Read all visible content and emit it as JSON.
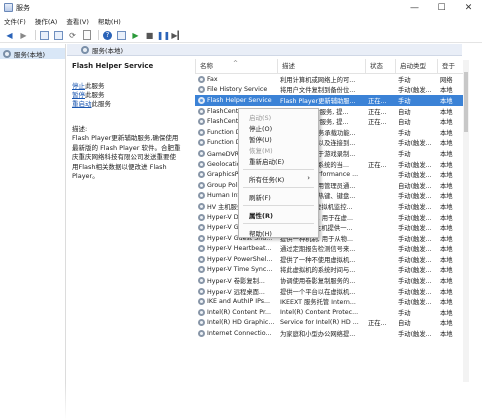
{
  "window": {
    "title": "服务",
    "controls": {
      "minimize": "—",
      "maximize": "☐",
      "close": "✕"
    }
  },
  "menubar": [
    "文件(F)",
    "操作(A)",
    "查看(V)",
    "帮助(H)"
  ],
  "tree": {
    "root": "服务(本地)"
  },
  "pane": {
    "header": "服务(本地)"
  },
  "description": {
    "service_name": "Flash Helper Service",
    "links": [
      {
        "link": "停止",
        "rest": "此服务"
      },
      {
        "link": "暂停",
        "rest": "此服务"
      },
      {
        "link": "重启动",
        "rest": "此服务"
      }
    ],
    "label": "描述:",
    "lines": [
      "Flash Player更新辅助服务,确保使用",
      "最新版的 Flash Player 软件。合肥重",
      "庆重庆网络科技有限公司发送重要使",
      "用Flash相关数据以便改进 Flash",
      "Player。"
    ]
  },
  "table": {
    "headers": [
      "名称",
      "描述",
      "状态",
      "启动类型",
      "登于"
    ],
    "rows": [
      {
        "name": "Fax",
        "desc": "利用计算机或网络上的可...",
        "status": "",
        "start": "手动",
        "logon": "网络"
      },
      {
        "name": "File History Service",
        "desc": "将用户文件复制到备份位...",
        "status": "",
        "start": "手动(触发...",
        "logon": "本地"
      },
      {
        "name": "Flash Helper Service",
        "desc": "Flash Player更新辅助服...",
        "status": "正在...",
        "start": "手动",
        "logon": "本地"
      },
      {
        "name": "FlashCenterSvc",
        "desc": "Flash Center服务, 提...",
        "status": "正在...",
        "start": "自动",
        "logon": "本地"
      },
      {
        "name": "FlashCenterSvc",
        "desc": "Flash Center服务, 提...",
        "status": "正在...",
        "start": "自动",
        "logon": "本地"
      },
      {
        "name": "Function Discovery...",
        "desc": "FDPHOST 服务承载功能...",
        "status": "",
        "start": "手动",
        "logon": "本地"
      },
      {
        "name": "Function Discovery...",
        "desc": "发布该计算机以及连接到...",
        "status": "",
        "start": "手动(触发...",
        "logon": "本地"
      },
      {
        "name": "GameDVR 和广播...",
        "desc": "此用户服务用于游戏录制...",
        "status": "",
        "start": "手动",
        "logon": "本地"
      },
      {
        "name": "Geolocation Service",
        "desc": "此服务将监视系统的当...",
        "status": "正在...",
        "start": "手动(触发...",
        "logon": "本地"
      },
      {
        "name": "GraphicsPerfSvc",
        "desc": "Graphics performance ...",
        "status": "",
        "start": "手动(触发...",
        "logon": "本地"
      },
      {
        "name": "Group Policy Client",
        "desc": "此服务负责应用管理员通...",
        "status": "",
        "start": "自动(触发...",
        "logon": "本地"
      },
      {
        "name": "Human Interface D...",
        "desc": "激活和维护对热键、键盘...",
        "status": "",
        "start": "手动(触发...",
        "logon": "本地"
      },
      {
        "name": "HV 主机服务",
        "desc": "为 Hyper-V 虚拟机监控...",
        "status": "",
        "start": "手动(触发...",
        "logon": "本地"
      },
      {
        "name": "Hyper-V Data Exch...",
        "desc": "提供一种机制, 用于在虚...",
        "status": "",
        "start": "手动(触发...",
        "logon": "本地"
      },
      {
        "name": "Hyper-V Guest Ser...",
        "desc": "为 Hyper-V 主机提供一...",
        "status": "",
        "start": "手动(触发...",
        "logon": "本地"
      },
      {
        "name": "Hyper-V Guest Shu...",
        "desc": "提供一种机制, 用于从物...",
        "status": "",
        "start": "手动(触发...",
        "logon": "本地"
      },
      {
        "name": "Hyper-V Heartbeat...",
        "desc": "通过定期报告检测信号来...",
        "status": "",
        "start": "手动(触发...",
        "logon": "本地"
      },
      {
        "name": "Hyper-V PowerShel...",
        "desc": "提供了一种不使用虚拟机...",
        "status": "",
        "start": "手动(触发...",
        "logon": "本地"
      },
      {
        "name": "Hyper-V Time Sync...",
        "desc": "将此虚拟机的系统时间与...",
        "status": "",
        "start": "手动(触发...",
        "logon": "本地"
      },
      {
        "name": "Hyper-V 卷影复制...",
        "desc": "协调使用卷影复制服务的...",
        "status": "",
        "start": "手动(触发...",
        "logon": "本地"
      },
      {
        "name": "Hyper-V 远程桌面...",
        "desc": "提供一个平台以在虚拟机...",
        "status": "",
        "start": "手动(触发...",
        "logon": "本地"
      },
      {
        "name": "IKE and AuthIP IPs...",
        "desc": "IKEEXT 服务托管 Intern...",
        "status": "",
        "start": "手动(触发...",
        "logon": "本地"
      },
      {
        "name": "Intel(R) Content Pr...",
        "desc": "Intel(R) Content Protec...",
        "status": "",
        "start": "手动",
        "logon": "本地"
      },
      {
        "name": "Intel(R) HD Graphic...",
        "desc": "Service for Intel(R) HD ...",
        "status": "正在...",
        "start": "自动",
        "logon": "本地"
      },
      {
        "name": "Internet Connectio...",
        "desc": "为家庭和小型办公网络提...",
        "status": "",
        "start": "手动(触发...",
        "logon": "本地"
      }
    ],
    "selected_index": 2
  },
  "context_menu": {
    "items": [
      {
        "label": "启动(S)",
        "disabled": true
      },
      {
        "label": "停止(O)",
        "disabled": false
      },
      {
        "label": "暂停(U)",
        "disabled": false
      },
      {
        "label": "恢复(M)",
        "disabled": true
      },
      {
        "label": "重新启动(E)",
        "disabled": false
      },
      {
        "sep": true
      },
      {
        "label": "所有任务(K)",
        "disabled": false,
        "submenu": true
      },
      {
        "sep": true
      },
      {
        "label": "刷新(F)",
        "disabled": false
      },
      {
        "sep": true
      },
      {
        "label": "属性(R)",
        "disabled": false,
        "bold": true
      },
      {
        "sep": true
      },
      {
        "label": "帮助(H)",
        "disabled": false
      }
    ]
  },
  "colors": {
    "selection": "#3b82d6",
    "link": "#1a56b0"
  }
}
